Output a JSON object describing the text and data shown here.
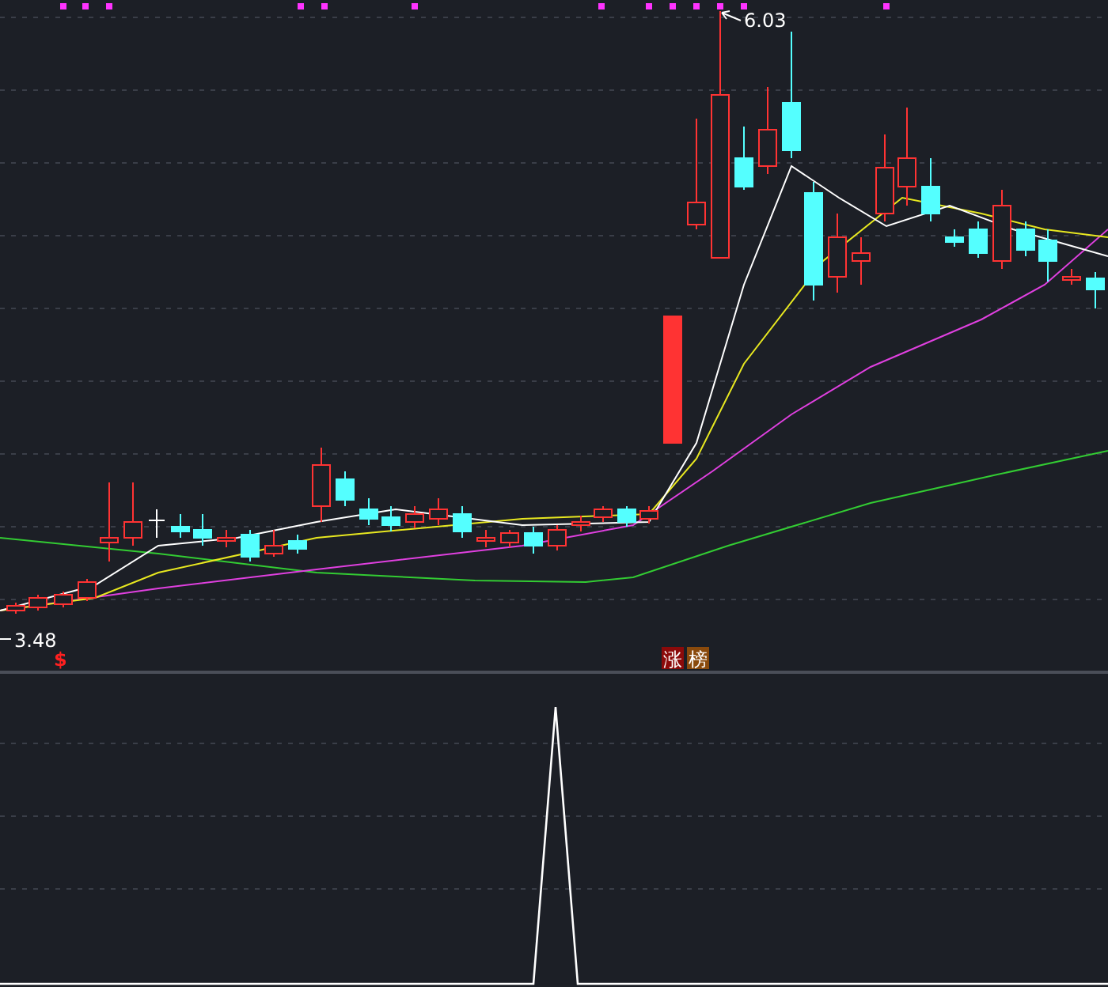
{
  "chart": {
    "high_label": "6.03",
    "low_label": "3.48",
    "signal_marker": "$",
    "badges": [
      {
        "text": "涨",
        "color": "#8b0a0a"
      },
      {
        "text": "榜",
        "color": "#8a4a0c"
      }
    ]
  }
}
